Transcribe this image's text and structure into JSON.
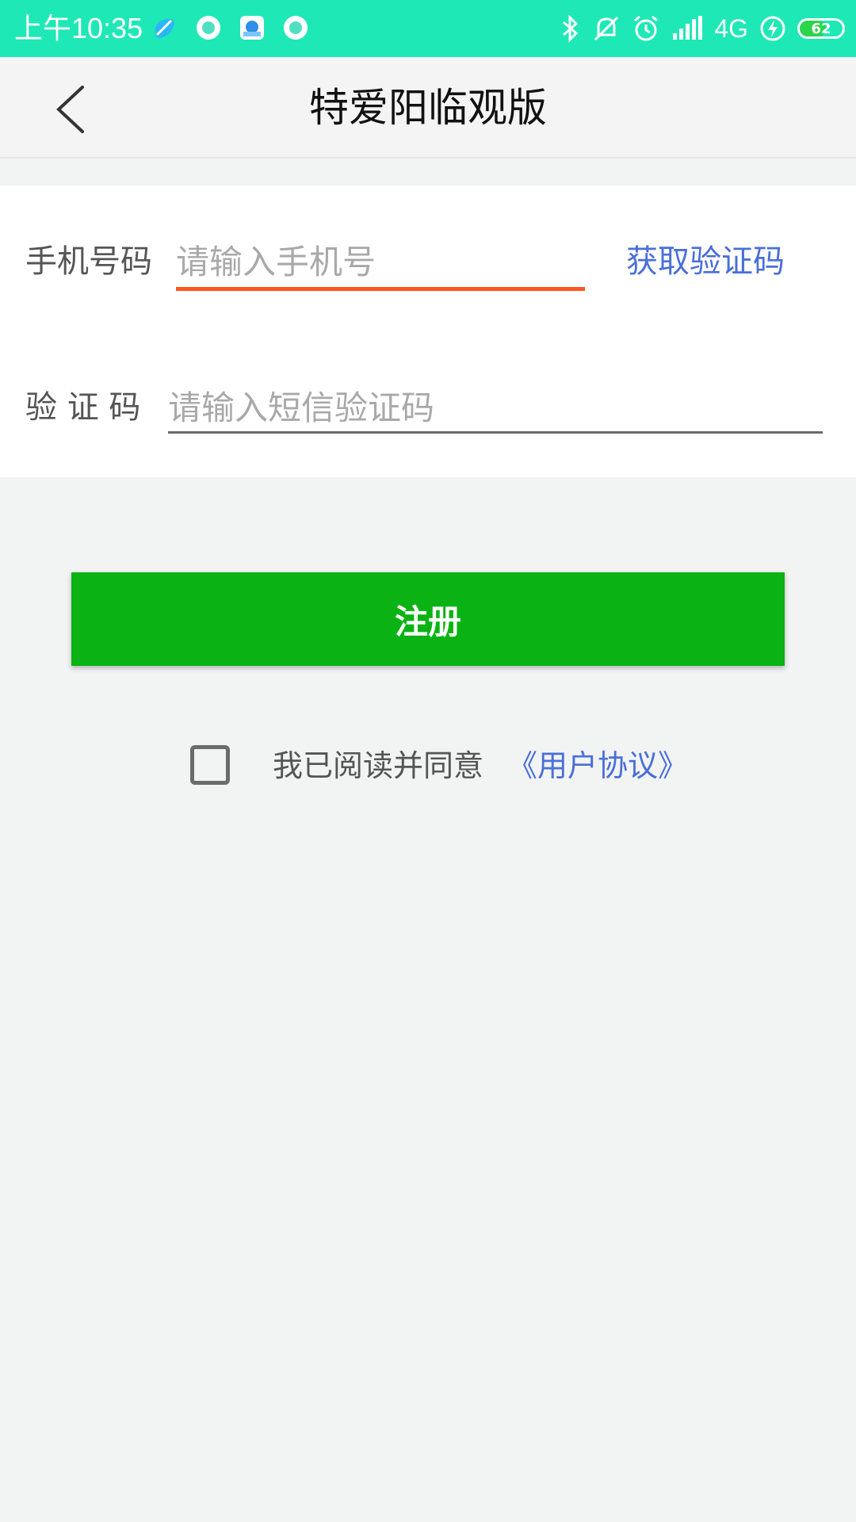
{
  "status_bar": {
    "time": "上午10:35",
    "network": "4G",
    "battery": "62",
    "icons": [
      "app-icon-1",
      "app-icon-2",
      "app-icon-3",
      "app-icon-4",
      "bluetooth-icon",
      "mute-icon",
      "alarm-icon",
      "signal-icon",
      "charging-icon",
      "battery-icon"
    ]
  },
  "header": {
    "title": "特爱阳临观版",
    "back_icon": "chevron-left-icon"
  },
  "form": {
    "phone_label": "手机号码",
    "phone_placeholder": "请输入手机号",
    "get_code_label": "获取验证码",
    "code_label": "验 证 码",
    "code_placeholder": "请输入短信验证码"
  },
  "register_button": "注册",
  "agreement": {
    "prefix": "我已阅读并同意",
    "link": "《用户协议》"
  },
  "colors": {
    "status_bar": "#1ee8b6",
    "accent_underline": "#ff5722",
    "link": "#4a6fd8",
    "button": "#0ab313",
    "background": "#f2f3f3"
  }
}
